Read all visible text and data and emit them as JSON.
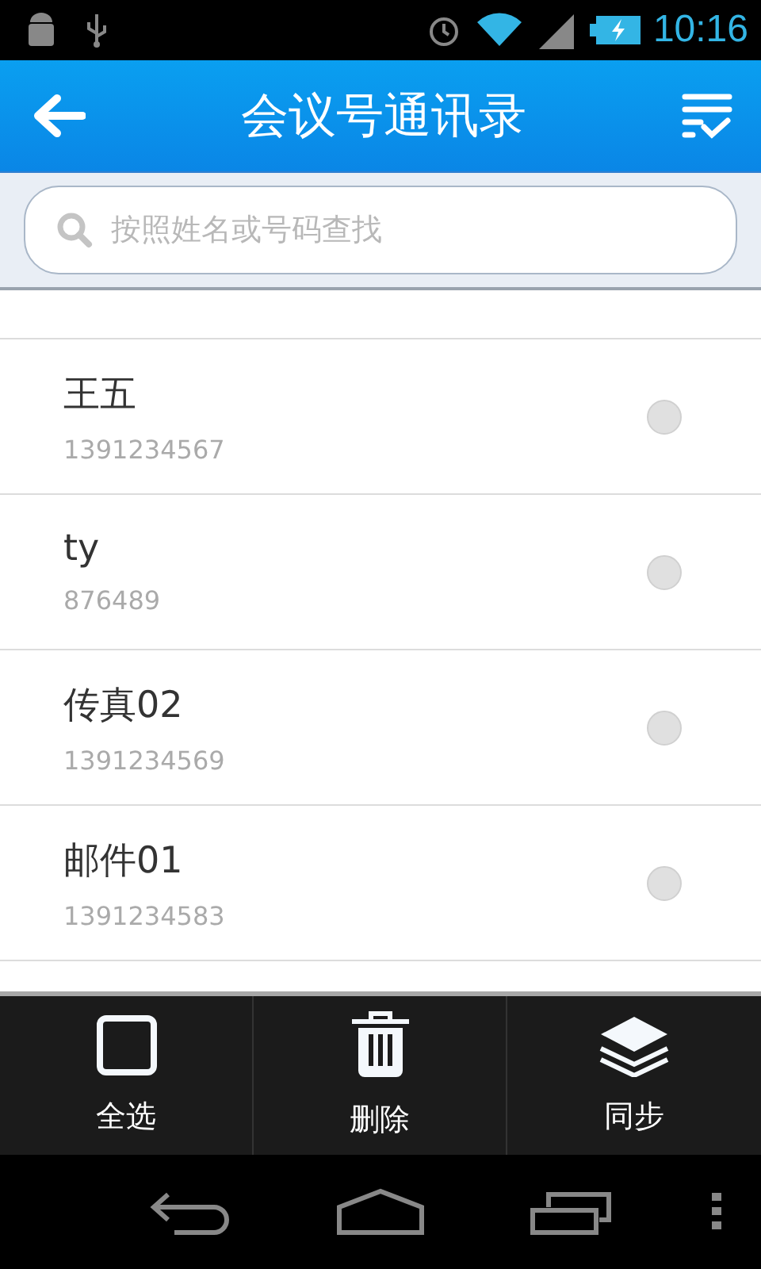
{
  "status_bar": {
    "time": "10:16"
  },
  "header": {
    "title": "会议号通讯录"
  },
  "search": {
    "placeholder": "按照姓名或号码查找"
  },
  "contacts": [
    {
      "name": "王五",
      "number": "1391234567",
      "selected": false
    },
    {
      "name": "ty",
      "number": "876489",
      "selected": false
    },
    {
      "name": "传真02",
      "number": "1391234569",
      "selected": false
    },
    {
      "name": "邮件01",
      "number": "1391234583",
      "selected": false
    }
  ],
  "toolbar": [
    {
      "kind": "select_all",
      "label": "全选"
    },
    {
      "kind": "delete",
      "label": "删除"
    },
    {
      "kind": "sync",
      "label": "同步"
    }
  ]
}
